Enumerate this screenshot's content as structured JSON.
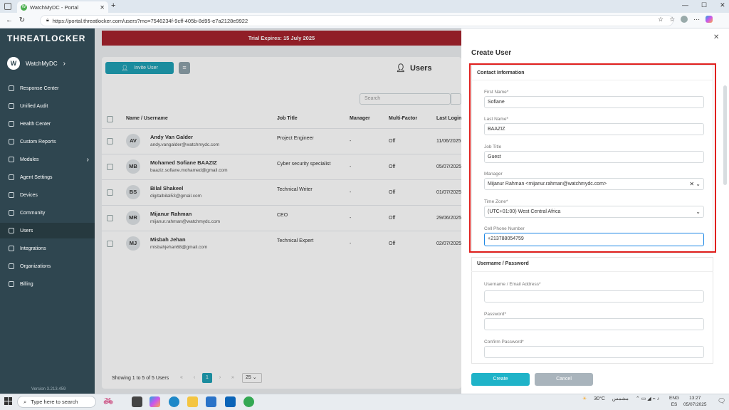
{
  "browser": {
    "tab_title": "WatchMyDC - Portal",
    "url": "https://portal.threatlocker.com/users?mo=7546234f-9cff-405b-8d95-e7a2128e9922"
  },
  "app": {
    "logo": "THREATLOCKER",
    "trial_banner": "Trial Expires: 15 July 2025",
    "account": {
      "initial": "W",
      "name": "WatchMyDC"
    },
    "version": "Version 3.213.459"
  },
  "sidebar": {
    "items": [
      {
        "label": "Response Center"
      },
      {
        "label": "Unified Audit"
      },
      {
        "label": "Health Center"
      },
      {
        "label": "Custom Reports"
      },
      {
        "label": "Modules"
      },
      {
        "label": "Agent Settings"
      },
      {
        "label": "Devices"
      },
      {
        "label": "Community"
      },
      {
        "label": "Users"
      },
      {
        "label": "Integrations"
      },
      {
        "label": "Organizations"
      },
      {
        "label": "Billing"
      }
    ],
    "active": "Users"
  },
  "users_page": {
    "invite_label": "Invite User",
    "title": "Users",
    "search_placeholder": "Search",
    "columns": [
      "Name / Username",
      "Job Title",
      "Manager",
      "Multi-Factor",
      "Last Login"
    ],
    "rows": [
      {
        "initials": "AV",
        "name": "Andy Van Galder",
        "email": "andy.vangalder@watchmydc.com",
        "job": "Project Engineer",
        "manager": "-",
        "mfa": "Off",
        "last_login": "11/06/2025,"
      },
      {
        "initials": "MB",
        "name": "Mohamed Sofiane BAAZIZ",
        "email": "baaziz.sofiane.mohamed@gmail.com",
        "job": "Cyber security specialist",
        "manager": "-",
        "mfa": "Off",
        "last_login": "05/07/2025"
      },
      {
        "initials": "BS",
        "name": "Bilal  Shakeel",
        "email": "digitalbilal53@gmail.com",
        "job": "Technical Writer",
        "manager": "-",
        "mfa": "Off",
        "last_login": "01/07/2025"
      },
      {
        "initials": "MR",
        "name": "Mijanur Rahman",
        "email": "mijanur.rahman@watchmydc.com",
        "job": "CEO",
        "manager": "-",
        "mfa": "Off",
        "last_login": "29/06/2025"
      },
      {
        "initials": "MJ",
        "name": "Misbah Jehan",
        "email": "misbahjehan68@gmail.com",
        "job": "Technical Expert",
        "manager": "-",
        "mfa": "Off",
        "last_login": "02/07/2025"
      }
    ],
    "pagination": {
      "summary": "Showing 1 to 5 of 5 Users",
      "current_page": "1",
      "page_size": "25"
    }
  },
  "create_user": {
    "title": "Create User",
    "contact_section": "Contact Information",
    "fields": {
      "first_name": {
        "label": "First Name*",
        "value": "Sofiane"
      },
      "last_name": {
        "label": "Last Name*",
        "value": "BAAZIZ"
      },
      "job_title": {
        "label": "Job Title",
        "value": "Guest"
      },
      "manager": {
        "label": "Manager",
        "value": "Mijanur Rahman <mijanur.rahman@watchmydc.com>"
      },
      "time_zone": {
        "label": "Time Zone*",
        "value": "(UTC+01:00) West Central Africa"
      },
      "cell_phone": {
        "label": "Cell Phone Number",
        "value": "+213788054759"
      }
    },
    "credentials_section": "Username / Password",
    "cred_fields": {
      "username": {
        "label": "Username / Email Address*",
        "value": ""
      },
      "password": {
        "label": "Password*",
        "value": ""
      },
      "confirm_password": {
        "label": "Confirm Password*",
        "value": ""
      }
    },
    "create_label": "Create",
    "cancel_label": "Cancel",
    "highlight_color": "#e0201e"
  },
  "taskbar": {
    "search_placeholder": "Type here to search",
    "weather": "30°C",
    "weather_text": "مشمس",
    "language": "ENG",
    "region": "ES",
    "time": "13:27",
    "date": "05/07/2025"
  }
}
